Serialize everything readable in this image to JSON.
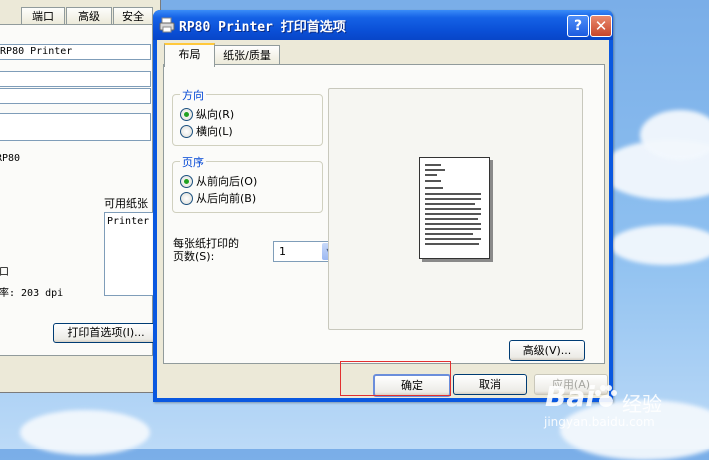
{
  "background_window": {
    "tabs": [
      "端口",
      "高级",
      "安全"
    ],
    "printer_name": "RP80 Printer",
    "model": "RP80",
    "available_paper_label": "可用纸张",
    "paper_list": [
      "Printer"
    ],
    "char_mouth": "口",
    "resolution": "率: 203 dpi",
    "preferences_button": "打印首选项(I)..."
  },
  "dialog": {
    "title": "RP80 Printer 打印首选项",
    "help_button": "?",
    "close_button": "✕",
    "tabs": [
      "布局",
      "纸张/质量"
    ],
    "active_tab": "布局",
    "orientation": {
      "title": "方向",
      "options": [
        "纵向(R)",
        "横向(L)"
      ],
      "selected": "纵向(R)"
    },
    "page_order": {
      "title": "页序",
      "options": [
        "从前向后(O)",
        "从后向前(B)"
      ],
      "selected": "从前向后(O)"
    },
    "pages_per_sheet": {
      "label_line1": "每张纸打印的",
      "label_line2": "页数(S):",
      "value": "1"
    },
    "advanced_button": "高级(V)...",
    "ok_button": "确定",
    "cancel_button": "取消",
    "apply_button": "应用(A)"
  },
  "watermark": {
    "brand": "Bai",
    "brand_suffix": "经验",
    "url": "jingyan.baidu.com"
  },
  "colors": {
    "title_blue": "#0a58e0",
    "group_title": "#0046d5",
    "highlight_box": "#e23030"
  },
  "icons": [
    "printer-icon",
    "help-icon",
    "close-icon",
    "dropdown-arrow-icon",
    "paw-icon"
  ]
}
